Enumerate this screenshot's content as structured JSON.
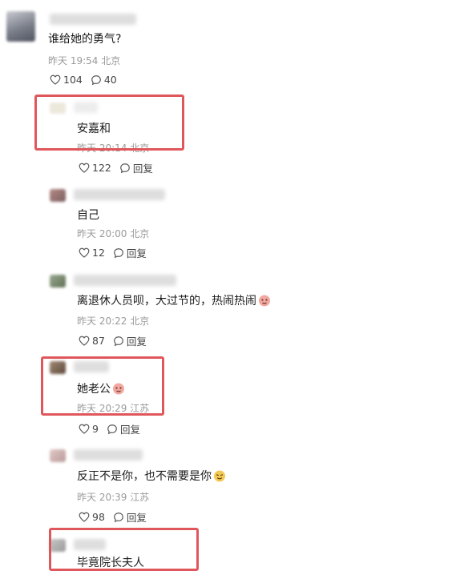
{
  "comment": {
    "text": "谁给她的勇气?",
    "meta": "昨天 19:54 北京",
    "likes": "104",
    "replies": "40"
  },
  "replies": [
    {
      "text": "安嘉和",
      "meta": "昨天 20:14 北京",
      "likes": "122",
      "reply_label": "回复"
    },
    {
      "text": "自己",
      "meta": "昨天 20:00 北京",
      "likes": "12",
      "reply_label": "回复"
    },
    {
      "text": "离退休人员呗，大过节的，热闹热闹",
      "meta": "昨天 20:22 北京",
      "likes": "87",
      "reply_label": "回复"
    },
    {
      "text": "她老公",
      "meta": "昨天 20:29 江苏",
      "likes": "9",
      "reply_label": "回复"
    },
    {
      "text": "反正不是你，也不需要是你",
      "meta": "昨天 20:39 江苏",
      "likes": "98",
      "reply_label": "回复"
    },
    {
      "text": "毕竟院长夫人"
    }
  ],
  "colors": {
    "highlight": "#e0575b",
    "meta": "#9a9a9a"
  },
  "icons": [
    "heart-icon",
    "comment-bubble-icon",
    "emoji-icon"
  ]
}
